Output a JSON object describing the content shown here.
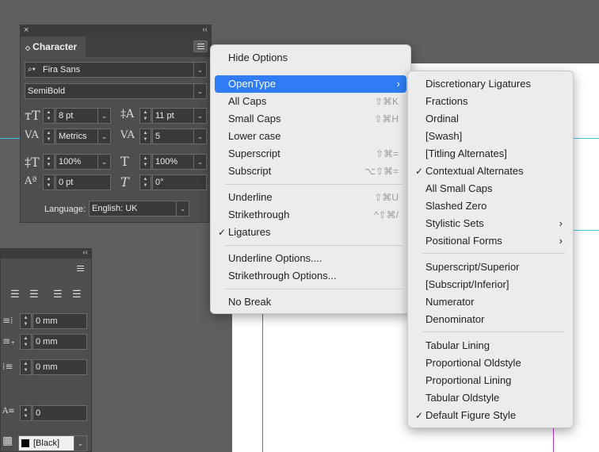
{
  "colors": {
    "accent": "#2f7cf6",
    "guide_cyan": "#3ec8e6",
    "guide_magenta": "#c03ac8"
  },
  "character_panel": {
    "close_glyph": "×",
    "collapse_glyph": "‹‹",
    "tab_title": "Character",
    "font_family": "Fira Sans",
    "font_style": "SemiBold",
    "font_size": "8 pt",
    "leading": "11 pt",
    "kerning": "Metrics",
    "tracking": "5",
    "vertical_scale": "100%",
    "horizontal_scale": "100%",
    "baseline_shift": "0 pt",
    "skew": "0°",
    "language_label": "Language:",
    "language_value": "English: UK"
  },
  "paragraph_panel": {
    "collapse_glyph": "‹‹",
    "left_indent": "0 mm",
    "first_line_indent": "0 mm",
    "space_after": "0 mm",
    "drop_cap_lines": "0",
    "swatch_label": "[Black]"
  },
  "main_menu": {
    "items": [
      {
        "label": "Hide Options",
        "shortcut": ""
      },
      {
        "label": "OpenType",
        "shortcut": "",
        "submenu": true,
        "highlighted": true
      },
      {
        "label": "All Caps",
        "shortcut": "⇧⌘K"
      },
      {
        "label": "Small Caps",
        "shortcut": "⇧⌘H"
      },
      {
        "label": "Lower case",
        "shortcut": ""
      },
      {
        "label": "Superscript",
        "shortcut": "⇧⌘="
      },
      {
        "label": "Subscript",
        "shortcut": "⌥⇧⌘="
      },
      {
        "label": "Underline",
        "shortcut": "⇧⌘U"
      },
      {
        "label": "Strikethrough",
        "shortcut": "^⇧⌘/"
      },
      {
        "label": "Ligatures",
        "shortcut": "",
        "checked": true
      },
      {
        "label": "Underline Options....",
        "shortcut": ""
      },
      {
        "label": "Strikethrough Options...",
        "shortcut": ""
      },
      {
        "label": "No Break",
        "shortcut": ""
      }
    ]
  },
  "opentype_menu": {
    "items": [
      {
        "label": "Discretionary Ligatures"
      },
      {
        "label": "Fractions"
      },
      {
        "label": "Ordinal"
      },
      {
        "label": "[Swash]"
      },
      {
        "label": "[Titling Alternates]"
      },
      {
        "label": "Contextual Alternates",
        "checked": true
      },
      {
        "label": "All Small Caps"
      },
      {
        "label": "Slashed Zero"
      },
      {
        "label": "Stylistic Sets",
        "submenu": true
      },
      {
        "label": "Positional Forms",
        "submenu": true
      },
      {
        "label": "Superscript/Superior"
      },
      {
        "label": "[Subscript/Inferior]"
      },
      {
        "label": "Numerator"
      },
      {
        "label": "Denominator"
      },
      {
        "label": "Tabular Lining"
      },
      {
        "label": "Proportional Oldstyle"
      },
      {
        "label": "Proportional Lining"
      },
      {
        "label": "Tabular Oldstyle"
      },
      {
        "label": "Default Figure Style",
        "checked": true
      }
    ]
  }
}
